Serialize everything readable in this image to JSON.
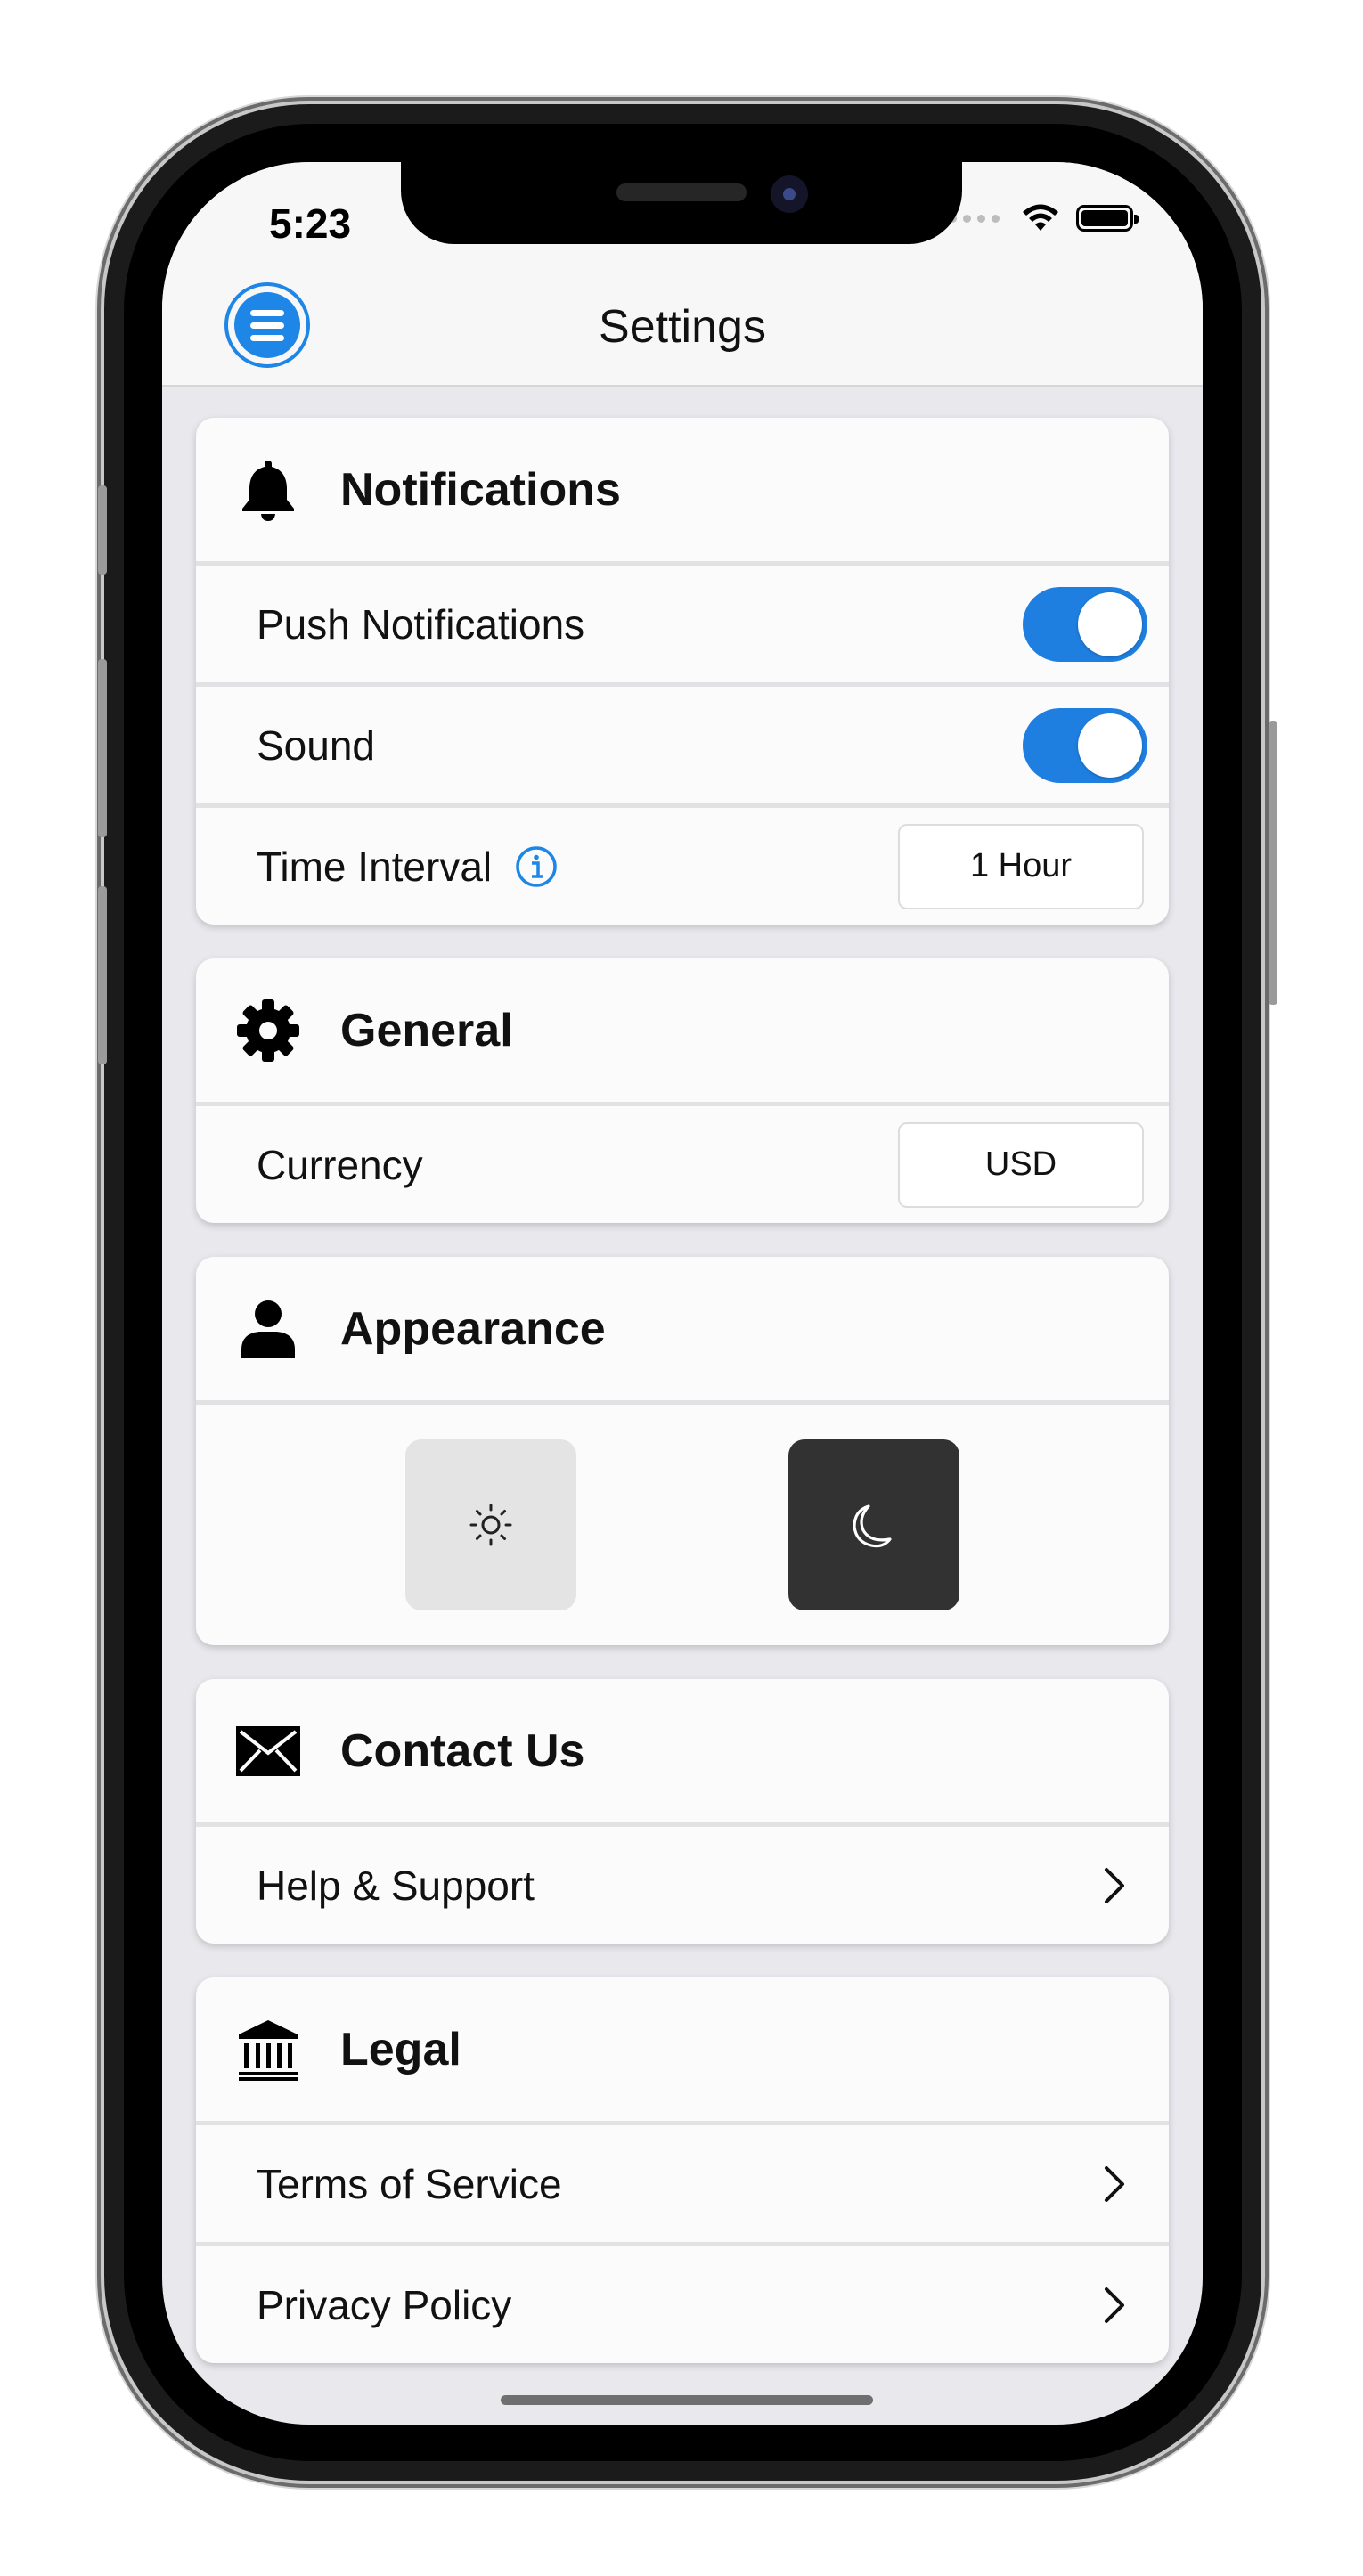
{
  "status_bar": {
    "time": "5:23"
  },
  "navbar": {
    "title": "Settings"
  },
  "sections": {
    "notifications": {
      "title": "Notifications",
      "push_label": "Push Notifications",
      "sound_label": "Sound",
      "interval_label": "Time Interval",
      "interval_value": "1 Hour",
      "push_on": true,
      "sound_on": true
    },
    "general": {
      "title": "General",
      "currency_label": "Currency",
      "currency_value": "USD"
    },
    "appearance": {
      "title": "Appearance",
      "options": [
        "light",
        "dark"
      ]
    },
    "contact": {
      "title": "Contact Us",
      "help_label": "Help & Support"
    },
    "legal": {
      "title": "Legal",
      "terms_label": "Terms of Service",
      "privacy_label": "Privacy Policy"
    }
  },
  "colors": {
    "accent": "#1e7fe0",
    "background": "#e9e8ed",
    "card": "#fbfbfb",
    "dark_theme_button": "#323232",
    "light_theme_button": "#e4e4e4"
  },
  "icons": {
    "menu": "hamburger-menu-icon",
    "notifications": "bell-icon",
    "general": "gear-icon",
    "appearance": "person-icon",
    "contact": "envelope-icon",
    "legal": "bank-icon",
    "info": "info-icon",
    "light": "sun-icon",
    "dark": "moon-icon",
    "chevron": "chevron-right-icon"
  }
}
